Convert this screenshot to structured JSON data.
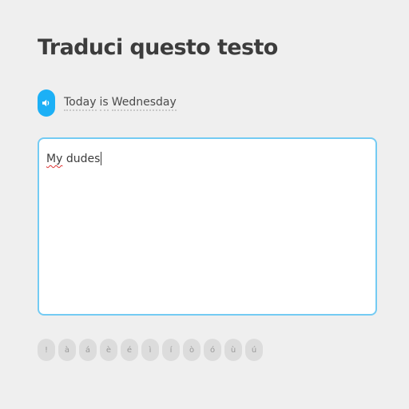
{
  "header": {
    "title": "Traduci questo testo"
  },
  "prompt": {
    "audio_icon": "speaker-icon",
    "words": [
      "Today",
      "is",
      "Wednesday"
    ]
  },
  "answer": {
    "first_word": "My",
    "rest": " dudes"
  },
  "accent_keys": [
    "!",
    "à",
    "á",
    "è",
    "é",
    "ì",
    "í",
    "ò",
    "ó",
    "ù",
    "ú"
  ],
  "colors": {
    "accent": "#1cb0f6",
    "input_border": "#74cbf3",
    "spell_error": "#dd3333"
  }
}
